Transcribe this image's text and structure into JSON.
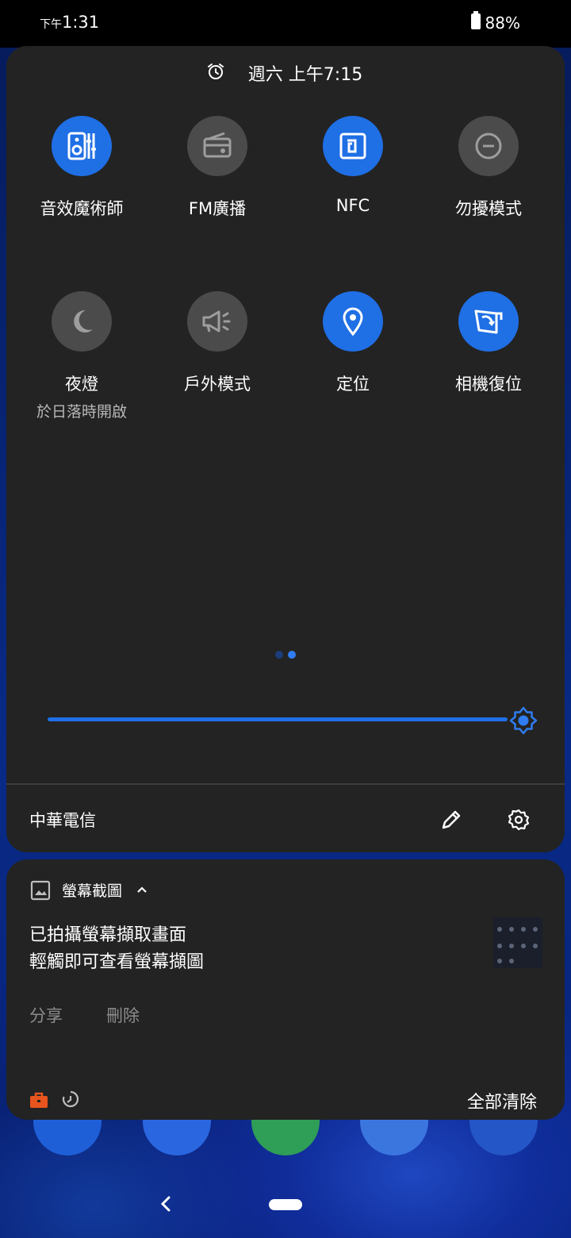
{
  "status_bar": {
    "ampm": "下午",
    "time": "1:31",
    "battery": "88%"
  },
  "quick_settings": {
    "alarm": "週六 上午7:15",
    "tiles": [
      {
        "label": "音效魔術師",
        "state": "on",
        "icon": "audio-wizard-icon"
      },
      {
        "label": "FM廣播",
        "state": "off",
        "icon": "radio-icon"
      },
      {
        "label": "NFC",
        "state": "on",
        "icon": "nfc-icon"
      },
      {
        "label": "勿擾模式",
        "state": "off",
        "icon": "do-not-disturb-icon"
      },
      {
        "label": "夜燈",
        "sublabel": "於日落時開啟",
        "state": "off",
        "icon": "moon-icon"
      },
      {
        "label": "戶外模式",
        "state": "off",
        "icon": "megaphone-icon"
      },
      {
        "label": "定位",
        "state": "on",
        "icon": "location-pin-icon"
      },
      {
        "label": "相機復位",
        "state": "on",
        "icon": "camera-reset-icon"
      }
    ],
    "page_count": 2,
    "current_page": 2,
    "brightness": 1.0,
    "carrier": "中華電信"
  },
  "notification": {
    "app": "螢幕截圖",
    "title": "已拍攝螢幕擷取畫面",
    "text": "輕觸即可查看螢幕擷圖",
    "actions": [
      "分享",
      "刪除"
    ],
    "clear_all": "全部清除"
  },
  "colors": {
    "accent": "#1f6fe5",
    "panel": "#232323",
    "tile_off": "#4b4b4b"
  }
}
